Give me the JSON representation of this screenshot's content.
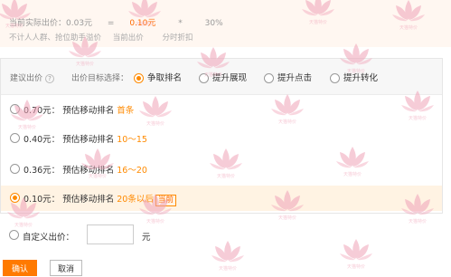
{
  "formula": {
    "actual_label": "当前实际出价：0.03元",
    "equals": "=",
    "base_value": "0.10元",
    "times": "*",
    "percent": "30%",
    "note1": "不计人人群、抢位助手溢价",
    "note2": "当前出价",
    "note3": "分时折扣"
  },
  "panel": {
    "suggest_label": "建议出价",
    "help_icon": "?",
    "goal_label": "出价目标选择：",
    "goals": [
      {
        "label": "争取排名",
        "checked": true
      },
      {
        "label": "提升展现",
        "checked": false
      },
      {
        "label": "提升点击",
        "checked": false
      },
      {
        "label": "提升转化",
        "checked": false
      }
    ],
    "options": [
      {
        "price": "0.70元：",
        "desc": "预估移动排名",
        "rank": "首条",
        "badge": "",
        "checked": false
      },
      {
        "price": "0.40元：",
        "desc": "预估移动排名",
        "rank": "10～15",
        "badge": "",
        "checked": false
      },
      {
        "price": "0.36元：",
        "desc": "预估移动排名",
        "rank": "16～20",
        "badge": "",
        "checked": false
      },
      {
        "price": "0.10元：",
        "desc": "预估移动排名",
        "rank": "20条以后",
        "badge": "当前",
        "checked": true
      }
    ]
  },
  "custom": {
    "label": "自定义出价：",
    "value": "",
    "unit": "元"
  },
  "buttons": {
    "confirm": "确认",
    "cancel": "取消"
  },
  "watermark_text": "天猫特价",
  "colors": {
    "accent": "#ff8a00",
    "confirm_bg": "#ff7a00",
    "selected_row_bg": "#fff3e3",
    "watermark": "#f0a3b8"
  }
}
